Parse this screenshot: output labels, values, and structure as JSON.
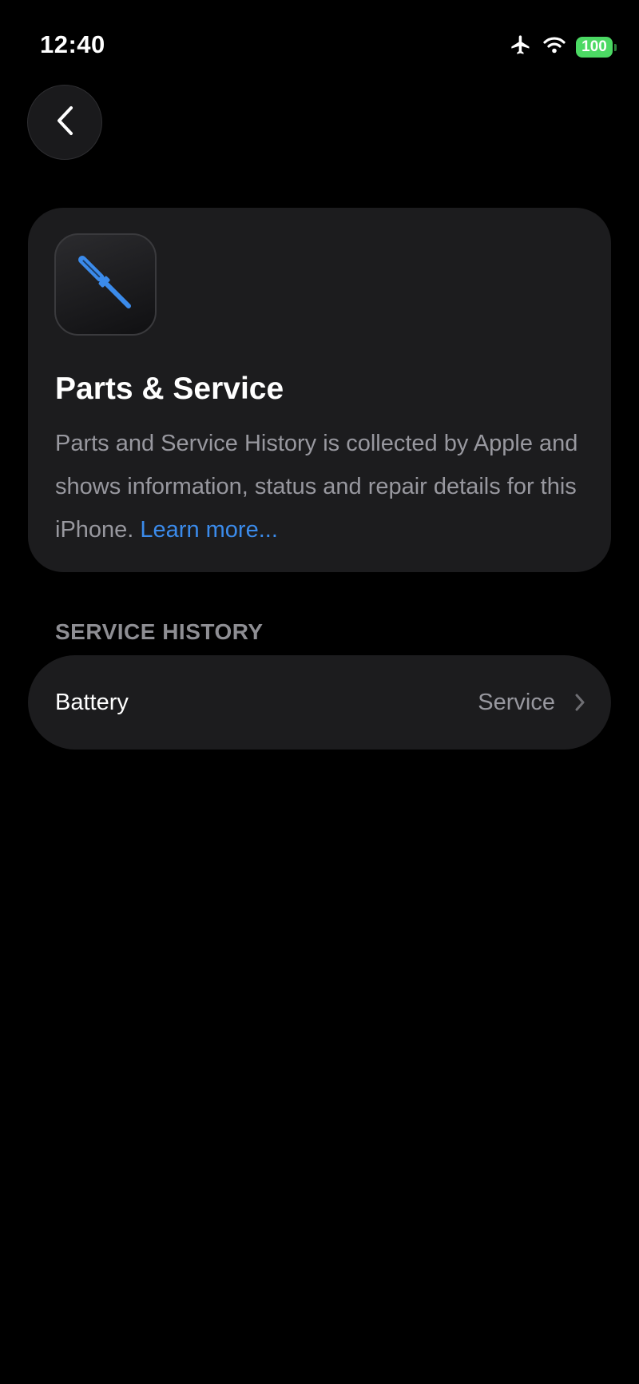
{
  "status_bar": {
    "time": "12:40",
    "battery_level": "100",
    "icons": [
      "airplane-icon",
      "wifi-icon",
      "battery-icon"
    ],
    "battery_color": "#4cd964"
  },
  "navigation": {
    "back_icon": "chevron-left-icon"
  },
  "card": {
    "icon": "screwdriver-icon",
    "icon_color": "#3b8beb",
    "title": "Parts & Service",
    "description": "Parts and Service History is collected by Apple and shows information, status and repair details for this iPhone.",
    "link_label": "Learn more..."
  },
  "service_history": {
    "header": "SERVICE HISTORY",
    "rows": [
      {
        "label": "Battery",
        "value": "Service",
        "chevron": "chevron-right-icon"
      }
    ]
  },
  "colors": {
    "background": "#000000",
    "card_background": "#1c1c1e",
    "secondary_text": "#98989f",
    "link": "#3b8beb"
  }
}
